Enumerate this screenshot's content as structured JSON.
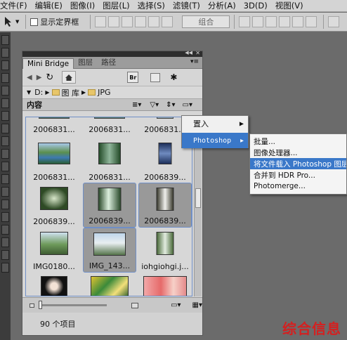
{
  "menubar": {
    "items": [
      "文件(F)",
      "编辑(E)",
      "图像(I)",
      "图层(L)",
      "选择(S)",
      "滤镜(T)",
      "分析(A)",
      "3D(D)",
      "视图(V)"
    ]
  },
  "options": {
    "show_bounds_label": "显示定界框",
    "group_label": "组合"
  },
  "panel": {
    "tabs": [
      "Mini Bridge",
      "图层",
      "路径"
    ],
    "path": {
      "drive": "D:",
      "folder1": "图 库",
      "folder2": "JPG"
    },
    "content_label": "内容",
    "items": [
      {
        "label": "2006831...",
        "selected": false
      },
      {
        "label": "2006831...",
        "selected": false
      },
      {
        "label": "2006831...",
        "selected": false
      },
      {
        "label": "2006831...",
        "selected": false
      },
      {
        "label": "2006831...",
        "selected": false
      },
      {
        "label": "2006839...",
        "selected": false
      },
      {
        "label": "2006839...",
        "selected": false
      },
      {
        "label": "2006839...",
        "selected": true
      },
      {
        "label": "2006839...",
        "selected": true
      },
      {
        "label": "IMG0180...",
        "selected": false
      },
      {
        "label": "IMG_143...",
        "selected": true
      },
      {
        "label": "iohgiohgi.j...",
        "selected": false
      },
      {
        "label": "",
        "selected": false
      },
      {
        "label": "",
        "selected": false
      },
      {
        "label": "",
        "selected": false
      }
    ],
    "status": "90 个项目"
  },
  "context_menu": {
    "items": [
      {
        "label": "置入"
      },
      {
        "label": "Photoshop"
      }
    ]
  },
  "submenu": {
    "items": [
      "批量...",
      "图像处理器...",
      "将文件载入 Photoshop 图层",
      "合并到 HDR Pro...",
      "Photomerge..."
    ]
  },
  "watermark": "综合信息"
}
